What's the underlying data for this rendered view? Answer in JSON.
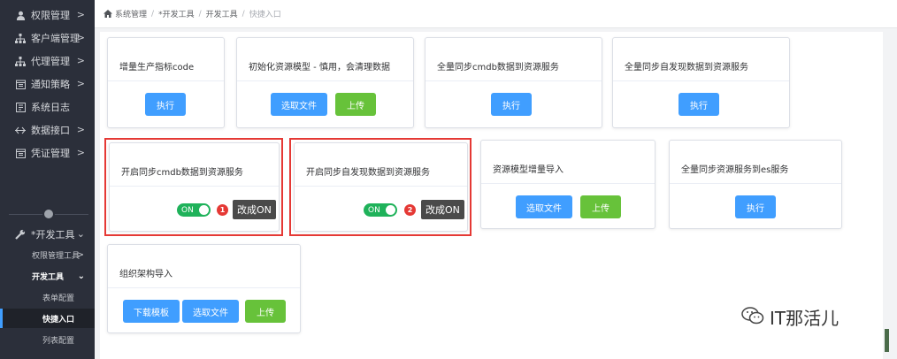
{
  "sidebar": {
    "items": [
      {
        "label": "权限管理",
        "icon": "user-icon"
      },
      {
        "label": "客户端管理",
        "icon": "sitemap-icon"
      },
      {
        "label": "代理管理",
        "icon": "sitemap-icon"
      },
      {
        "label": "通知策略",
        "icon": "calendar-icon"
      },
      {
        "label": "系统日志",
        "icon": "log-icon"
      },
      {
        "label": "数据接口",
        "icon": "interface-icon"
      },
      {
        "label": "凭证管理",
        "icon": "calendar-icon"
      }
    ],
    "dev_tools": {
      "label": "*开发工具",
      "icon": "wrench-icon"
    },
    "sub_items": [
      {
        "label": "权限管理工具"
      },
      {
        "label": "开发工具"
      },
      {
        "label": "表单配置"
      },
      {
        "label": "快捷入口"
      },
      {
        "label": "列表配置"
      }
    ]
  },
  "breadcrumb": {
    "home": "系统管理",
    "level2": "*开发工具",
    "level3": "开发工具",
    "current": "快捷入口"
  },
  "cards": [
    {
      "title": "增量生产指标code",
      "buttons": [
        "执行"
      ]
    },
    {
      "title": "初始化资源模型 - 慎用，会清理数据",
      "buttons": [
        "选取文件",
        "上传"
      ]
    },
    {
      "title": "全量同步cmdb数据到资源服务",
      "buttons": [
        "执行"
      ]
    },
    {
      "title": "全量同步自发现数据到资源服务",
      "buttons": [
        "执行"
      ]
    },
    {
      "title": "开启同步cmdb数据到资源服务",
      "toggle": "ON",
      "badge": "1",
      "tip": "改成ON"
    },
    {
      "title": "开启同步自发现数据到资源服务",
      "toggle": "ON",
      "badge": "2",
      "tip": "改成ON"
    },
    {
      "title": "资源模型增量导入",
      "buttons": [
        "选取文件",
        "上传"
      ]
    },
    {
      "title": "全量同步资源服务到es服务",
      "buttons": [
        "执行"
      ]
    },
    {
      "title": "组织架构导入",
      "buttons": [
        "下载模板",
        "选取文件",
        "上传"
      ]
    }
  ],
  "watermark": "IT那活儿",
  "colors": {
    "accent_blue": "#409eff",
    "accent_green": "#67c23a",
    "toggle_green": "#1fb25a",
    "highlight_red": "#e53935",
    "sidebar_bg": "#2b2f3a"
  }
}
